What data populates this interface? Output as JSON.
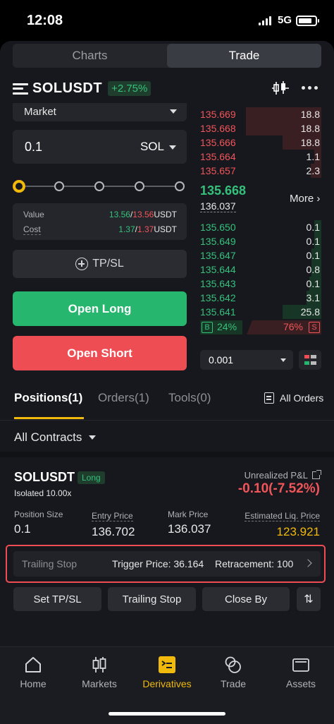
{
  "status": {
    "time": "12:08",
    "network": "5G"
  },
  "header_tabs": {
    "charts": "Charts",
    "trade": "Trade"
  },
  "symbol": {
    "name": "SOLUSDT",
    "change": "+2.75%"
  },
  "order_form": {
    "order_type": "Market",
    "quantity": "0.1",
    "quantity_unit": "SOL",
    "leverage_slider_position": 0,
    "value_label": "Value",
    "value_buy": "13.56",
    "value_sell": "13.56",
    "value_unit": "USDT",
    "cost_label": "Cost",
    "cost_buy": "1.37",
    "cost_sell": "1.37",
    "cost_unit": "USDT",
    "tpsl_label": "TP/SL",
    "open_long": "Open Long",
    "open_short": "Open Short"
  },
  "orderbook": {
    "asks": [
      {
        "price": "135.669",
        "qty": "18.8",
        "depth": 0.62
      },
      {
        "price": "135.668",
        "qty": "18.8",
        "depth": 0.62
      },
      {
        "price": "135.666",
        "qty": "18.8",
        "depth": 0.32
      },
      {
        "price": "135.664",
        "qty": "1.1",
        "depth": 0.06
      },
      {
        "price": "135.657",
        "qty": "2.3",
        "depth": 0.09
      }
    ],
    "last_price": "135.668",
    "mark_price": "136.037",
    "more": "More",
    "bids": [
      {
        "price": "135.650",
        "qty": "0.1",
        "depth": 0.06
      },
      {
        "price": "135.649",
        "qty": "0.1",
        "depth": 0.06
      },
      {
        "price": "135.647",
        "qty": "0.1",
        "depth": 0.08
      },
      {
        "price": "135.644",
        "qty": "0.8",
        "depth": 0.08
      },
      {
        "price": "135.643",
        "qty": "0.1",
        "depth": 0.1
      },
      {
        "price": "135.642",
        "qty": "3.1",
        "depth": 0.12
      },
      {
        "price": "135.641",
        "qty": "25.8",
        "depth": 0.32
      }
    ],
    "buy_label": "B",
    "buy_pct": "24%",
    "sell_pct": "76%",
    "sell_label": "S",
    "depth_value": "0.001"
  },
  "tabs": {
    "positions": "Positions(1)",
    "orders": "Orders(1)",
    "tools": "Tools(0)",
    "all_orders": "All Orders"
  },
  "filter": {
    "contracts": "All Contracts"
  },
  "position": {
    "symbol": "SOLUSDT",
    "side": "Long",
    "margin": "Isolated 10.00x",
    "upnl_label": "Unrealized P&L",
    "upnl": "-0.10(-7.52%)",
    "size_label": "Position Size",
    "size": "0.1",
    "entry_label": "Entry Price",
    "entry": "136.702",
    "mark_label": "Mark Price",
    "mark": "136.037",
    "liq_label": "Estimated Liq. Price",
    "liq": "123.921",
    "trailing_label": "Trailing Stop",
    "trigger": "Trigger Price: 36.164",
    "retracement": "Retracement: 100",
    "btn_tpsl": "Set TP/SL",
    "btn_trailing": "Trailing Stop",
    "btn_close": "Close By",
    "btn_swap": "⇅"
  },
  "nav": {
    "home": "Home",
    "markets": "Markets",
    "derivatives": "Derivatives",
    "trade": "Trade",
    "assets": "Assets"
  },
  "colors": {
    "accent": "#f0b90b",
    "buy": "#27b66d",
    "sell": "#ee4d54"
  }
}
